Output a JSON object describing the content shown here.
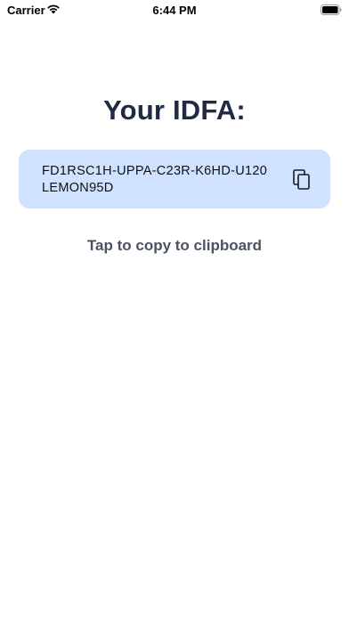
{
  "status_bar": {
    "carrier": "Carrier",
    "time": "6:44 PM",
    "icons": [
      "wifi-icon",
      "battery-icon"
    ]
  },
  "main": {
    "title": "Your IDFA:",
    "idfa_value": "FD1RSC1H-UPPA-C23R-K6HD-U120LEMON95D",
    "copy_icon": "copy-icon",
    "hint": "Tap to copy to clipboard"
  },
  "colors": {
    "title": "#1f2a44",
    "card_background": "#cfe2ff",
    "hint": "#4b5260"
  }
}
